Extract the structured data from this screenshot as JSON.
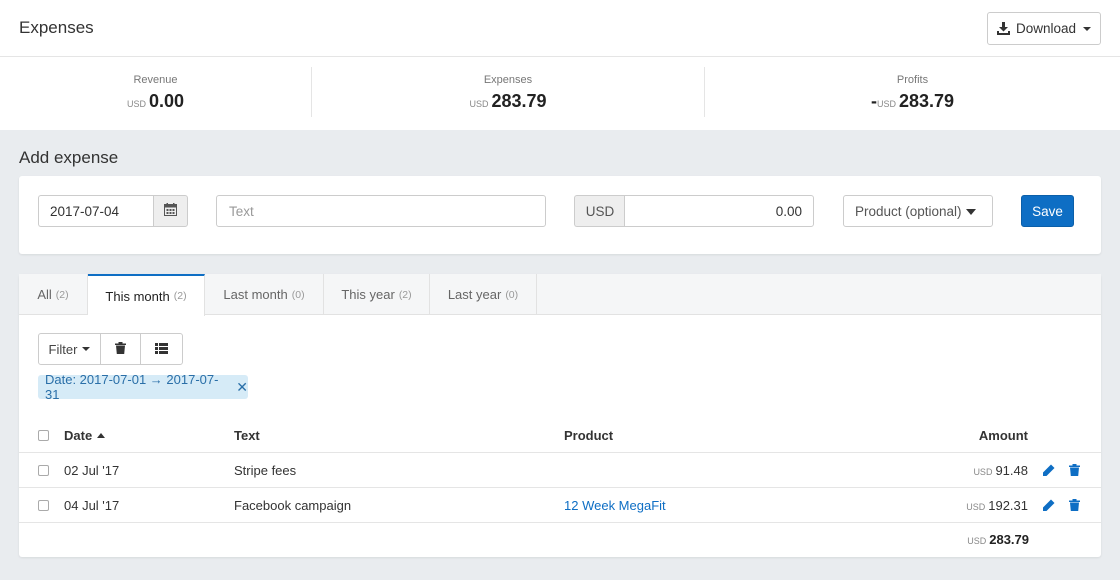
{
  "header": {
    "title": "Expenses",
    "download_label": "Download"
  },
  "stats": {
    "revenue": {
      "label": "Revenue",
      "currency": "USD",
      "value": "0.00"
    },
    "expenses": {
      "label": "Expenses",
      "currency": "USD",
      "value": "283.79"
    },
    "profits": {
      "label": "Profits",
      "sign": "-",
      "currency": "USD",
      "value": "283.79"
    }
  },
  "add_expense": {
    "title": "Add expense",
    "date_value": "2017-07-04",
    "text_placeholder": "Text",
    "currency": "USD",
    "amount_value": "0.00",
    "product_placeholder": "Product (optional)",
    "save_label": "Save"
  },
  "tabs": [
    {
      "label": "All",
      "count": "(2)"
    },
    {
      "label": "This month",
      "count": "(2)"
    },
    {
      "label": "Last month",
      "count": "(0)"
    },
    {
      "label": "This year",
      "count": "(2)"
    },
    {
      "label": "Last year",
      "count": "(0)"
    }
  ],
  "active_tab": "This month",
  "toolbar": {
    "filter_label": "Filter"
  },
  "active_filter": "Date: 2017-07-01 → 2017-07-31",
  "table": {
    "headers": {
      "date": "Date",
      "text": "Text",
      "product": "Product",
      "amount": "Amount"
    },
    "rows": [
      {
        "date": "02 Jul '17",
        "text": "Stripe fees",
        "product": "",
        "currency": "USD",
        "amount": "91.48"
      },
      {
        "date": "04 Jul '17",
        "text": "Facebook campaign",
        "product": "12 Week MegaFit",
        "currency": "USD",
        "amount": "192.31"
      }
    ],
    "total": {
      "currency": "USD",
      "value": "283.79"
    }
  },
  "colors": {
    "accent": "#0e6ec4",
    "chip_bg": "#d6ebf7",
    "page_bg": "#e9ecef"
  }
}
